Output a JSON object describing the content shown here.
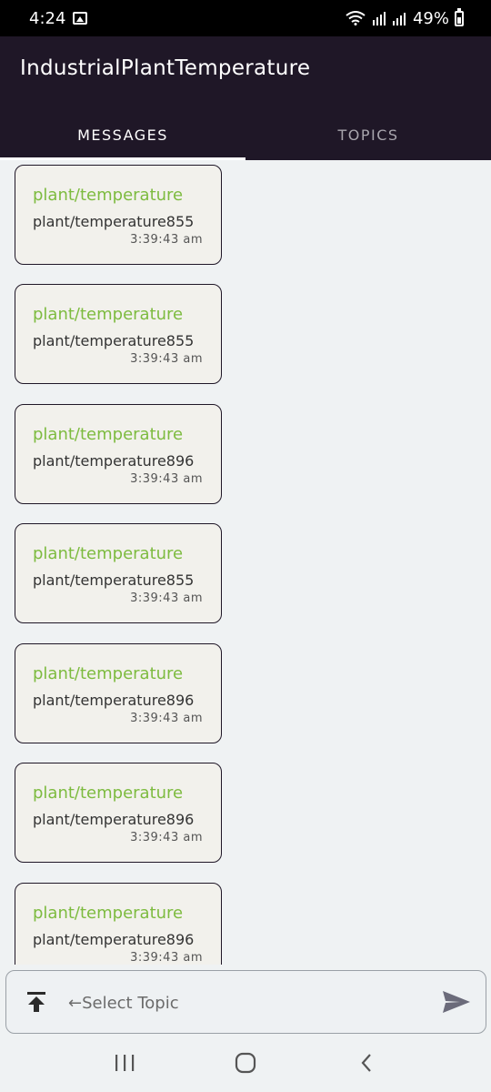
{
  "status_bar": {
    "time": "4:24",
    "battery": "49%"
  },
  "app": {
    "title": "IndustrialPlantTemperature"
  },
  "tabs": [
    {
      "label": "MESSAGES",
      "active": true
    },
    {
      "label": "TOPICS",
      "active": false
    }
  ],
  "messages": [
    {
      "topic": "plant/temperature",
      "payload": "plant/temperature855",
      "time": "3:39:43 am"
    },
    {
      "topic": "plant/temperature",
      "payload": "plant/temperature855",
      "time": "3:39:43 am"
    },
    {
      "topic": "plant/temperature",
      "payload": "plant/temperature896",
      "time": "3:39:43 am"
    },
    {
      "topic": "plant/temperature",
      "payload": "plant/temperature855",
      "time": "3:39:43 am"
    },
    {
      "topic": "plant/temperature",
      "payload": "plant/temperature896",
      "time": "3:39:43 am"
    },
    {
      "topic": "plant/temperature",
      "payload": "plant/temperature896",
      "time": "3:39:43 am"
    },
    {
      "topic": "plant/temperature",
      "payload": "plant/temperature896",
      "time": "3:39:43 am"
    }
  ],
  "input": {
    "placeholder": "←Select Topic"
  },
  "colors": {
    "app_bar": "#1f1727",
    "topic_green": "#7dbb3f",
    "background": "#eff2f3"
  }
}
